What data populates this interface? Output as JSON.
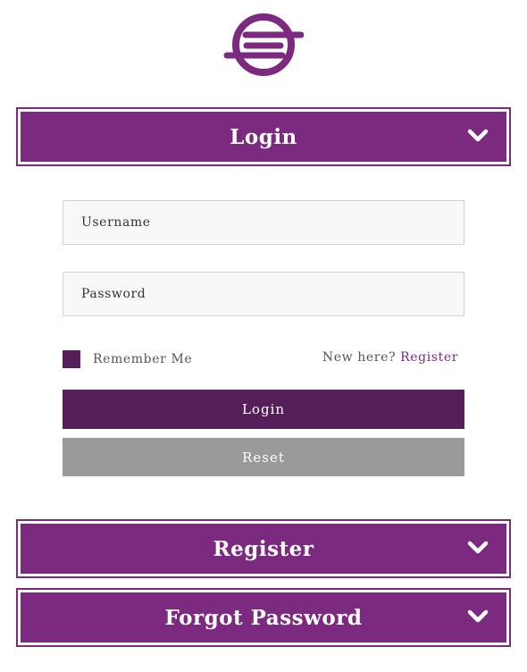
{
  "colors": {
    "accent": "#7b2a7f",
    "button_primary": "#55205a",
    "button_secondary": "#9a9a9a",
    "field_background": "#f8f8f8"
  },
  "logo": {
    "icon": "brand-logo-icon"
  },
  "sections": {
    "login": {
      "title": "Login",
      "icon": "chevron-down-icon"
    },
    "register": {
      "title": "Register",
      "icon": "chevron-down-icon"
    },
    "forgot_password": {
      "title": "Forgot Password",
      "icon": "chevron-down-icon"
    }
  },
  "login_form": {
    "username_placeholder": "Username",
    "password_placeholder": "Password",
    "remember_me_label": "Remember Me",
    "new_here_text": "New here?",
    "register_link": "Register",
    "login_button": "Login",
    "reset_button": "Reset"
  }
}
